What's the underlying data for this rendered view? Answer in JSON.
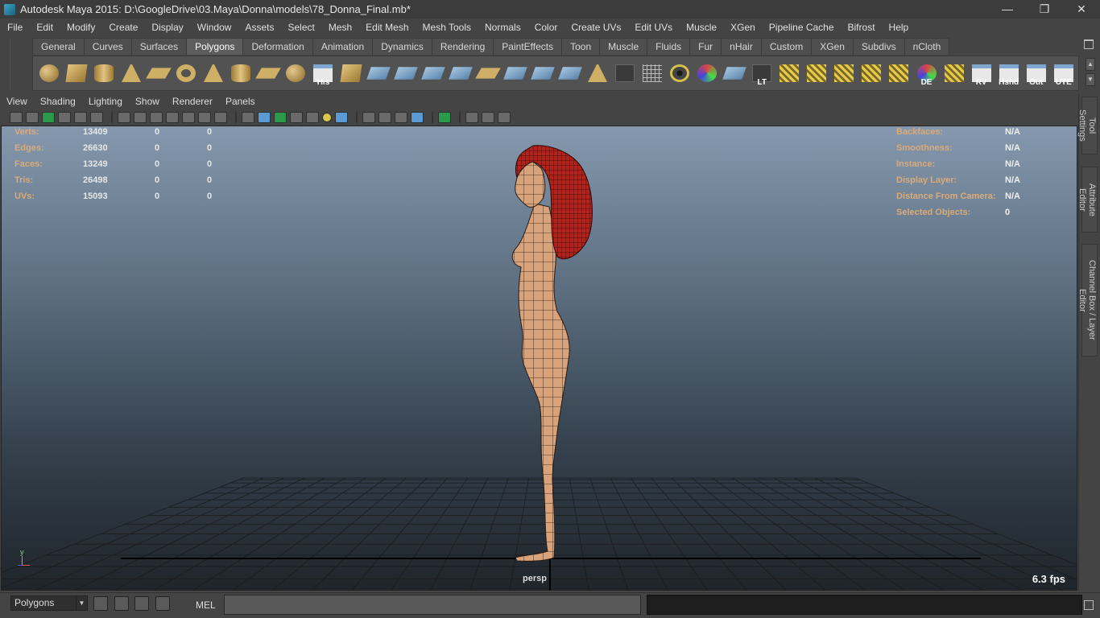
{
  "window": {
    "title": "Autodesk Maya 2015: D:\\GoogleDrive\\03.Maya\\Donna\\models\\78_Donna_Final.mb*",
    "minimize": "—",
    "restore": "❐",
    "close": "✕"
  },
  "menubar": [
    "File",
    "Edit",
    "Modify",
    "Create",
    "Display",
    "Window",
    "Assets",
    "Select",
    "Mesh",
    "Edit Mesh",
    "Mesh Tools",
    "Normals",
    "Color",
    "Create UVs",
    "Edit UVs",
    "Muscle",
    "XGen",
    "Pipeline Cache",
    "Bifrost",
    "Help"
  ],
  "shelf_tabs": [
    {
      "label": "General",
      "active": false
    },
    {
      "label": "Curves",
      "active": false
    },
    {
      "label": "Surfaces",
      "active": false
    },
    {
      "label": "Polygons",
      "active": true
    },
    {
      "label": "Deformation",
      "active": false
    },
    {
      "label": "Animation",
      "active": false
    },
    {
      "label": "Dynamics",
      "active": false
    },
    {
      "label": "Rendering",
      "active": false
    },
    {
      "label": "PaintEffects",
      "active": false
    },
    {
      "label": "Toon",
      "active": false
    },
    {
      "label": "Muscle",
      "active": false
    },
    {
      "label": "Fluids",
      "active": false
    },
    {
      "label": "Fur",
      "active": false
    },
    {
      "label": "nHair",
      "active": false
    },
    {
      "label": "Custom",
      "active": false
    },
    {
      "label": "XGen",
      "active": false
    },
    {
      "label": "Subdivs",
      "active": false
    },
    {
      "label": "nCloth",
      "active": false
    }
  ],
  "shelf_icons": [
    {
      "name": "poly-sphere-icon",
      "shape": "sphere",
      "label": ""
    },
    {
      "name": "poly-cube-icon",
      "shape": "cube",
      "label": ""
    },
    {
      "name": "poly-cylinder-icon",
      "shape": "cyl",
      "label": ""
    },
    {
      "name": "poly-cone-icon",
      "shape": "cone",
      "label": ""
    },
    {
      "name": "poly-plane-icon",
      "shape": "plane",
      "label": ""
    },
    {
      "name": "poly-torus-icon",
      "shape": "torus",
      "label": ""
    },
    {
      "name": "poly-pyramid-icon",
      "shape": "cone",
      "label": ""
    },
    {
      "name": "poly-pipe-icon",
      "shape": "cyl",
      "label": ""
    },
    {
      "name": "poly-helix-icon",
      "shape": "plane",
      "label": ""
    },
    {
      "name": "poly-soccer-icon",
      "shape": "sphere",
      "label": ""
    },
    {
      "name": "history-icon",
      "shape": "white",
      "label": "His"
    },
    {
      "name": "extrude-icon",
      "shape": "cube",
      "label": ""
    },
    {
      "name": "bevel-icon",
      "shape": "blue",
      "label": ""
    },
    {
      "name": "bridge-icon",
      "shape": "blue",
      "label": ""
    },
    {
      "name": "append-icon",
      "shape": "blue",
      "label": ""
    },
    {
      "name": "split-icon",
      "shape": "blue",
      "label": ""
    },
    {
      "name": "merge-icon",
      "shape": "plane",
      "label": ""
    },
    {
      "name": "combine-icon",
      "shape": "blue",
      "label": ""
    },
    {
      "name": "separate-icon",
      "shape": "blue",
      "label": ""
    },
    {
      "name": "boolean-icon",
      "shape": "blue",
      "label": ""
    },
    {
      "name": "sculpt-icon",
      "shape": "cone",
      "label": ""
    },
    {
      "name": "paint-icon",
      "shape": "dark",
      "label": ""
    },
    {
      "name": "wire-cube-icon",
      "shape": "grid",
      "label": ""
    },
    {
      "name": "target-icon",
      "shape": "ring",
      "label": ""
    },
    {
      "name": "transform-icon",
      "shape": "sphere-c",
      "label": ""
    },
    {
      "name": "render-cube-icon",
      "shape": "blue",
      "label": ""
    },
    {
      "name": "lt-icon",
      "shape": "dark",
      "label": "LT"
    },
    {
      "name": "uv-1-icon",
      "shape": "yellow",
      "label": ""
    },
    {
      "name": "uv-2-icon",
      "shape": "yellow",
      "label": ""
    },
    {
      "name": "uv-3-icon",
      "shape": "yellow",
      "label": ""
    },
    {
      "name": "uv-4-icon",
      "shape": "yellow",
      "label": ""
    },
    {
      "name": "uv-5-icon",
      "shape": "yellow",
      "label": ""
    },
    {
      "name": "de-icon",
      "shape": "sphere-c",
      "label": "DE"
    },
    {
      "name": "uv-6-icon",
      "shape": "yellow",
      "label": ""
    },
    {
      "name": "rv-icon",
      "shape": "white",
      "label": "RV"
    },
    {
      "name": "hshd-icon",
      "shape": "white",
      "label": "Hshd"
    },
    {
      "name": "out-icon",
      "shape": "white",
      "label": "Out"
    },
    {
      "name": "ute-icon",
      "shape": "white",
      "label": "UTE"
    }
  ],
  "panel_menu": [
    "View",
    "Shading",
    "Lighting",
    "Show",
    "Renderer",
    "Panels"
  ],
  "hud_left": [
    {
      "key": "Verts:",
      "a": "13409",
      "b": "0",
      "c": "0"
    },
    {
      "key": "Edges:",
      "a": "26630",
      "b": "0",
      "c": "0"
    },
    {
      "key": "Faces:",
      "a": "13249",
      "b": "0",
      "c": "0"
    },
    {
      "key": "Tris:",
      "a": "26498",
      "b": "0",
      "c": "0"
    },
    {
      "key": "UVs:",
      "a": "15093",
      "b": "0",
      "c": "0"
    }
  ],
  "hud_right": [
    {
      "key": "Backfaces:",
      "val": "N/A"
    },
    {
      "key": "Smoothness:",
      "val": "N/A"
    },
    {
      "key": "Instance:",
      "val": "N/A"
    },
    {
      "key": "Display Layer:",
      "val": "N/A"
    },
    {
      "key": "Distance From Camera:",
      "val": "N/A"
    },
    {
      "key": "Selected Objects:",
      "val": "0"
    }
  ],
  "viewport": {
    "camera": "persp",
    "fps": "6.3 fps",
    "axis_y": "y"
  },
  "right_dock": {
    "tool_settings": "Tool Settings",
    "attribute_editor": "Attribute Editor",
    "channel_box": "Channel Box / Layer Editor"
  },
  "bottom": {
    "mode": "Polygons",
    "mel_label": "MEL",
    "command_value": ""
  },
  "colors": {
    "hud_key": "#d9ab7a",
    "skin": "#d8a27a",
    "hair": "#b0221c"
  }
}
